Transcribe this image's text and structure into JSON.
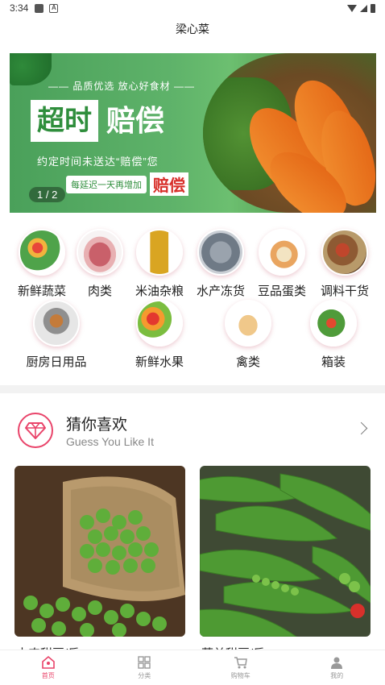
{
  "status_bar": {
    "time": "3:34"
  },
  "app": {
    "title": "梁心菜"
  },
  "banner": {
    "slogan_top": "—— 品质优选 放心好食材 ——",
    "headline_boxed": "超时",
    "headline_plain": "赔偿",
    "slogan_mid": "约定时间未送达“赔偿”您",
    "promo_text": "每延迟一天再增加",
    "promo_big": "赔偿",
    "indicator": "1 / 2"
  },
  "categories": [
    {
      "label": "新鲜蔬菜",
      "icon": "vegetables-icon"
    },
    {
      "label": "肉类",
      "icon": "meat-icon"
    },
    {
      "label": "米油杂粮",
      "icon": "oil-grain-icon"
    },
    {
      "label": "水产冻货",
      "icon": "seafood-icon"
    },
    {
      "label": "豆品蛋类",
      "icon": "egg-tofu-icon"
    },
    {
      "label": "调料干货",
      "icon": "seasoning-icon"
    },
    {
      "label": "厨房日用品",
      "icon": "kitchenware-icon"
    },
    {
      "label": "新鲜水果",
      "icon": "fruit-icon"
    },
    {
      "label": "禽类",
      "icon": "poultry-icon"
    },
    {
      "label": "箱装",
      "icon": "boxed-icon"
    }
  ],
  "guess": {
    "title": "猜你喜欢",
    "subtitle": "Guess You Like It"
  },
  "products": [
    {
      "name": "本农甜豆/斤"
    },
    {
      "name": "荷兰甜豆/斤"
    }
  ],
  "nav": {
    "home": "首页",
    "category": "分类",
    "cart": "购物车",
    "mine": "我的"
  },
  "colors": {
    "accent": "#e9446a",
    "banner_green": "#4aa05a"
  }
}
